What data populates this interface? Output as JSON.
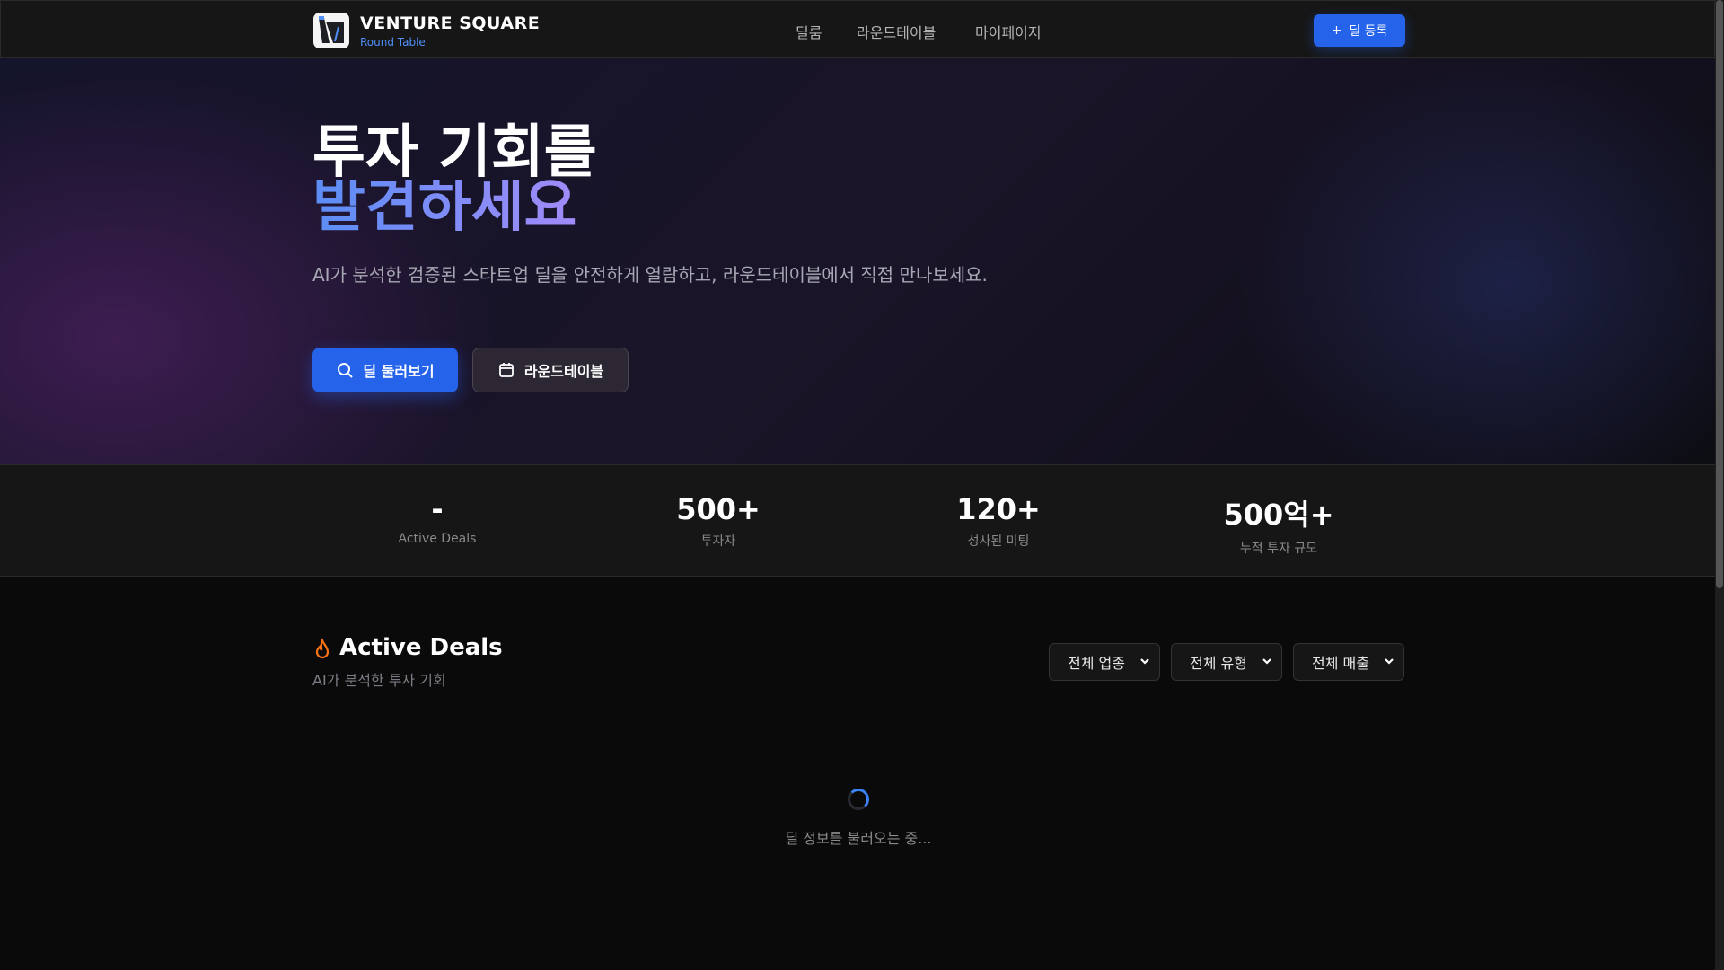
{
  "nav": {
    "brand": "VENTURE SQUARE",
    "brand_sub": "Round Table",
    "links": [
      "딜룸",
      "라운드테이블",
      "마이페이지"
    ],
    "register": "딜 등록"
  },
  "hero": {
    "title_line1": "투자 기회를",
    "title_line2": "발견하세요",
    "lead": "AI가 분석한 검증된 스타트업 딜을 안전하게 열람하고, 라운드테이블에서 직접 만나보세요.",
    "btn_browse": "딜 둘러보기",
    "btn_roundtable": "라운드테이블"
  },
  "stats": [
    {
      "value": "-",
      "label": "Active Deals"
    },
    {
      "value": "500+",
      "label": "투자자"
    },
    {
      "value": "120+",
      "label": "성사된 미팅"
    },
    {
      "value": "500억+",
      "label": "누적 투자 규모"
    }
  ],
  "deals": {
    "title": "Active Deals",
    "subtitle": "AI가 분석한 투자 기회",
    "filters": [
      "전체 업종",
      "전체 유형",
      "전체 매출"
    ],
    "loading": "딜 정보를 불러오는 중..."
  },
  "colors": {
    "accent": "#2563eb",
    "fire": "#f97316"
  }
}
